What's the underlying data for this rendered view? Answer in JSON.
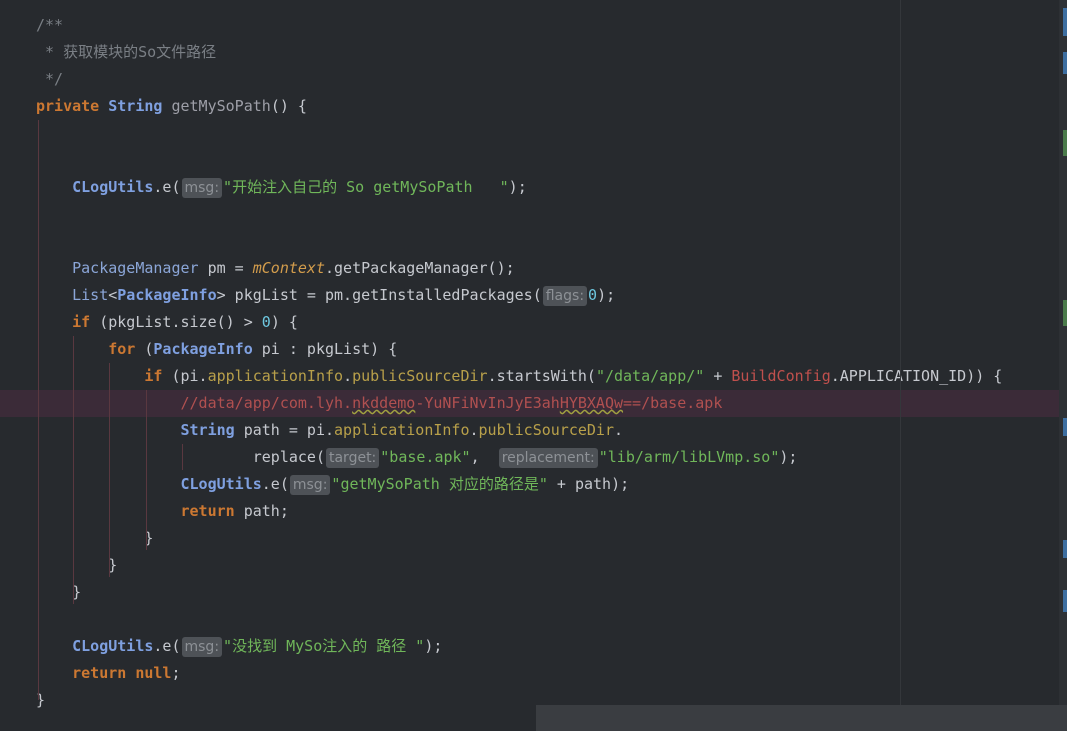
{
  "editor": {
    "lines": [
      {
        "tokens": [
          {
            "c": "t-comment",
            "t": "/**"
          }
        ]
      },
      {
        "tokens": [
          {
            "c": "t-comment",
            "t": " * 获取模块的So文件路径"
          }
        ]
      },
      {
        "tokens": [
          {
            "c": "t-comment",
            "t": " */"
          }
        ]
      },
      {
        "tokens": [
          {
            "c": "t-kw",
            "t": "private "
          },
          {
            "c": "t-classb",
            "t": "String "
          },
          {
            "c": "t-method",
            "t": "getMySoPath"
          },
          {
            "c": "t-plain",
            "t": "() {"
          }
        ]
      },
      {
        "tokens": []
      },
      {
        "tokens": []
      },
      {
        "tokens": [
          {
            "c": "t-plain",
            "t": "    "
          },
          {
            "c": "t-classb",
            "t": "CLogUtils"
          },
          {
            "c": "t-plain",
            "t": ".e("
          },
          {
            "c": "hint",
            "t": "msg:"
          },
          {
            "c": "t-str",
            "t": "\"开始注入自己的 So getMySoPath   \""
          },
          {
            "c": "t-plain",
            "t": ");"
          }
        ]
      },
      {
        "tokens": []
      },
      {
        "tokens": []
      },
      {
        "tokens": [
          {
            "c": "t-plain",
            "t": "    "
          },
          {
            "c": "t-type",
            "t": "PackageManager "
          },
          {
            "c": "t-plain",
            "t": "pm = "
          },
          {
            "c": "t-field",
            "t": "mContext"
          },
          {
            "c": "t-plain",
            "t": ".getPackageManager();"
          }
        ]
      },
      {
        "tokens": [
          {
            "c": "t-plain",
            "t": "    "
          },
          {
            "c": "t-type",
            "t": "List"
          },
          {
            "c": "t-plain",
            "t": "<"
          },
          {
            "c": "t-classb",
            "t": "PackageInfo"
          },
          {
            "c": "t-plain",
            "t": "> pkgList = pm.getInstalledPackages("
          },
          {
            "c": "hint",
            "t": "flags:"
          },
          {
            "c": "t-num",
            "t": "0"
          },
          {
            "c": "t-plain",
            "t": ");"
          }
        ]
      },
      {
        "tokens": [
          {
            "c": "t-plain",
            "t": "    "
          },
          {
            "c": "t-kw",
            "t": "if "
          },
          {
            "c": "t-plain",
            "t": "(pkgList.size() > "
          },
          {
            "c": "t-num",
            "t": "0"
          },
          {
            "c": "t-plain",
            "t": ") {"
          }
        ]
      },
      {
        "tokens": [
          {
            "c": "t-plain",
            "t": "        "
          },
          {
            "c": "t-kw",
            "t": "for "
          },
          {
            "c": "t-plain",
            "t": "("
          },
          {
            "c": "t-classb",
            "t": "PackageInfo "
          },
          {
            "c": "t-plain",
            "t": "pi : pkgList) {"
          }
        ]
      },
      {
        "tokens": [
          {
            "c": "t-plain",
            "t": "            "
          },
          {
            "c": "t-kw",
            "t": "if "
          },
          {
            "c": "t-plain",
            "t": "(pi."
          },
          {
            "c": "t-member",
            "t": "applicationInfo"
          },
          {
            "c": "t-plain",
            "t": "."
          },
          {
            "c": "t-member",
            "t": "publicSourceDir"
          },
          {
            "c": "t-plain",
            "t": ".startsWith("
          },
          {
            "c": "t-str",
            "t": "\"/data/app/\""
          },
          {
            "c": "t-plain",
            "t": " + "
          },
          {
            "c": "t-cls",
            "t": "BuildConfig"
          },
          {
            "c": "t-plain",
            "t": ".APPLICATION_ID)) {"
          }
        ]
      },
      {
        "highlight": true,
        "tokens": [
          {
            "c": "t-plain",
            "t": "                "
          },
          {
            "c": "t-lcomment",
            "t": "//data/app/com.lyh."
          },
          {
            "c": "t-lcomment t-warn",
            "t": "nkddemo"
          },
          {
            "c": "t-lcomment",
            "t": "-YuNFiNvInJyE3ah"
          },
          {
            "c": "t-lcomment t-warn",
            "t": "HYBXAQw"
          },
          {
            "c": "t-lcomment",
            "t": "==/base.apk"
          }
        ]
      },
      {
        "tokens": [
          {
            "c": "t-plain",
            "t": "                "
          },
          {
            "c": "t-classb",
            "t": "String "
          },
          {
            "c": "t-plain",
            "t": "path = pi."
          },
          {
            "c": "t-member",
            "t": "applicationInfo"
          },
          {
            "c": "t-plain",
            "t": "."
          },
          {
            "c": "t-member",
            "t": "publicSourceDir"
          },
          {
            "c": "t-plain",
            "t": "."
          }
        ]
      },
      {
        "tokens": [
          {
            "c": "t-plain",
            "t": "                        replace("
          },
          {
            "c": "hint",
            "t": "target:"
          },
          {
            "c": "t-str",
            "t": "\"base.apk\""
          },
          {
            "c": "t-plain",
            "t": ",  "
          },
          {
            "c": "hint",
            "t": "replacement:"
          },
          {
            "c": "t-str",
            "t": "\"lib/arm/libLVmp.so\""
          },
          {
            "c": "t-plain",
            "t": ");"
          }
        ]
      },
      {
        "tokens": [
          {
            "c": "t-plain",
            "t": "                "
          },
          {
            "c": "t-classb",
            "t": "CLogUtils"
          },
          {
            "c": "t-plain",
            "t": ".e("
          },
          {
            "c": "hint",
            "t": "msg:"
          },
          {
            "c": "t-str",
            "t": "\"getMySoPath 对应的路径是\""
          },
          {
            "c": "t-plain",
            "t": " + path);"
          }
        ]
      },
      {
        "tokens": [
          {
            "c": "t-plain",
            "t": "                "
          },
          {
            "c": "t-kw",
            "t": "return "
          },
          {
            "c": "t-plain",
            "t": "path;"
          }
        ]
      },
      {
        "tokens": [
          {
            "c": "t-plain",
            "t": "            }"
          }
        ]
      },
      {
        "tokens": [
          {
            "c": "t-plain",
            "t": "        }"
          }
        ]
      },
      {
        "tokens": [
          {
            "c": "t-plain",
            "t": "    }"
          }
        ]
      },
      {
        "tokens": []
      },
      {
        "tokens": [
          {
            "c": "t-plain",
            "t": "    "
          },
          {
            "c": "t-classb",
            "t": "CLogUtils"
          },
          {
            "c": "t-plain",
            "t": ".e("
          },
          {
            "c": "hint",
            "t": "msg:"
          },
          {
            "c": "t-str",
            "t": "\"没找到 MySo注入的 路径 \""
          },
          {
            "c": "t-plain",
            "t": ");"
          }
        ]
      },
      {
        "tokens": [
          {
            "c": "t-plain",
            "t": "    "
          },
          {
            "c": "t-kw",
            "t": "return null"
          },
          {
            "c": "t-plain",
            "t": ";"
          }
        ]
      },
      {
        "tokens": [
          {
            "c": "t-plain",
            "t": "}"
          }
        ]
      }
    ]
  },
  "colors": {
    "background": "#272a2e",
    "keyword": "#cc7832",
    "string": "#70b75a",
    "highlight_line": "#3b2b38"
  }
}
